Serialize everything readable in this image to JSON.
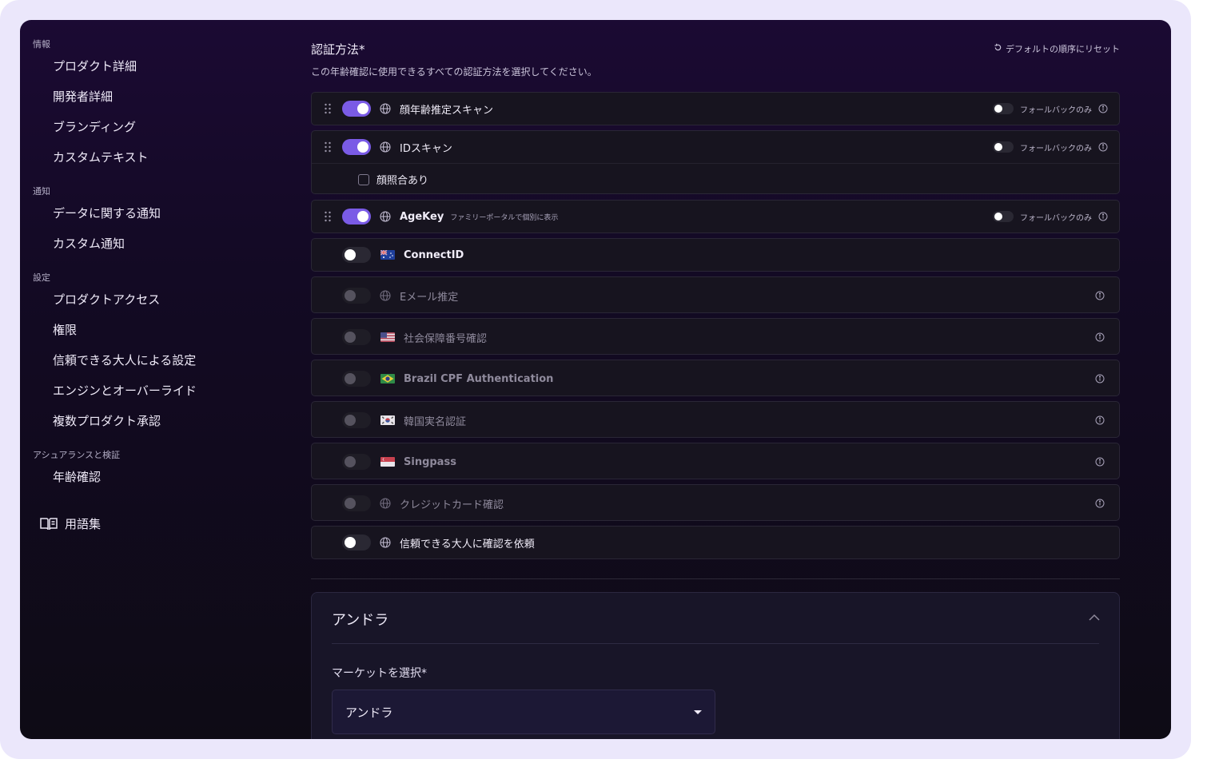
{
  "sidebar": {
    "sections": [
      {
        "title": "情報",
        "items": [
          "プロダクト詳細",
          "開発者詳細",
          "ブランディング",
          "カスタムテキスト"
        ]
      },
      {
        "title": "通知",
        "items": [
          "データに関する通知",
          "カスタム通知"
        ]
      },
      {
        "title": "設定",
        "items": [
          "プロダクトアクセス",
          "権限",
          "信頼できる大人による設定",
          "エンジンとオーバーライド",
          "複数プロダクト承認"
        ]
      },
      {
        "title": "アシュアランスと検証",
        "items": [
          "年齢確認"
        ]
      }
    ],
    "glossary_label": "用語集"
  },
  "auth": {
    "title": "認証方法*",
    "description": "この年齢確認に使用できるすべての認証方法を選択してください。",
    "reset_label": "デフォルトの順序にリセット",
    "fallback_label": "フォールバックのみ",
    "methods": [
      {
        "label": "顔年齢推定スキャン",
        "enabled": true,
        "icon": "globe-icon",
        "fallback_only": false
      },
      {
        "label": "IDスキャン",
        "enabled": true,
        "icon": "globe-icon",
        "fallback_only": false,
        "option_label": "顔照合あり",
        "option_checked": false
      },
      {
        "label": "AgeKey",
        "sublabel": "ファミリーポータルで個別に表示",
        "enabled": true,
        "icon": "globe-icon",
        "fallback_only": false
      },
      {
        "label": "ConnectID",
        "enabled": false,
        "icon": "flag-au-icon"
      },
      {
        "label": "Eメール推定",
        "enabled": false,
        "disabled": true,
        "icon": "globe-icon"
      },
      {
        "label": "社会保障番号確認",
        "enabled": false,
        "disabled": true,
        "icon": "flag-us-icon"
      },
      {
        "label": "Brazil CPF Authentication",
        "enabled": false,
        "disabled": true,
        "icon": "flag-br-icon"
      },
      {
        "label": "韓国実名認証",
        "enabled": false,
        "disabled": true,
        "icon": "flag-kr-icon"
      },
      {
        "label": "Singpass",
        "enabled": false,
        "disabled": true,
        "icon": "flag-sg-icon"
      },
      {
        "label": "クレジットカード確認",
        "enabled": false,
        "disabled": true,
        "icon": "globe-icon"
      },
      {
        "label": "信頼できる大人に確認を依頼",
        "enabled": false,
        "icon": "globe-icon"
      }
    ]
  },
  "country_panel": {
    "title": "アンドラ",
    "market_label": "マーケットを選択*",
    "market_value": "アンドラ"
  },
  "colors": {
    "accent": "#7a5be6",
    "background": "#130a24",
    "frame": "#ebe7fb"
  }
}
